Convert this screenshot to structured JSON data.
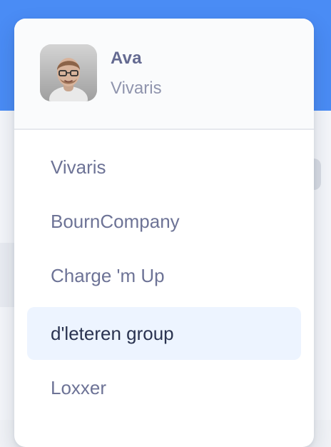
{
  "profile": {
    "name": "Ava",
    "company": "Vivaris",
    "avatar_icon": "user-photo-avatar"
  },
  "menu": {
    "selected_index": 3,
    "items": [
      {
        "label": "Vivaris"
      },
      {
        "label": "BournCompany"
      },
      {
        "label": "Charge 'm Up"
      },
      {
        "label": "d'leteren group"
      },
      {
        "label": "Loxxer"
      }
    ]
  },
  "colors": {
    "header_bg": "#4a8cf5",
    "selected_bg": "#edf4ff",
    "selected_text": "#2a3350",
    "menu_text": "#6d7396"
  }
}
